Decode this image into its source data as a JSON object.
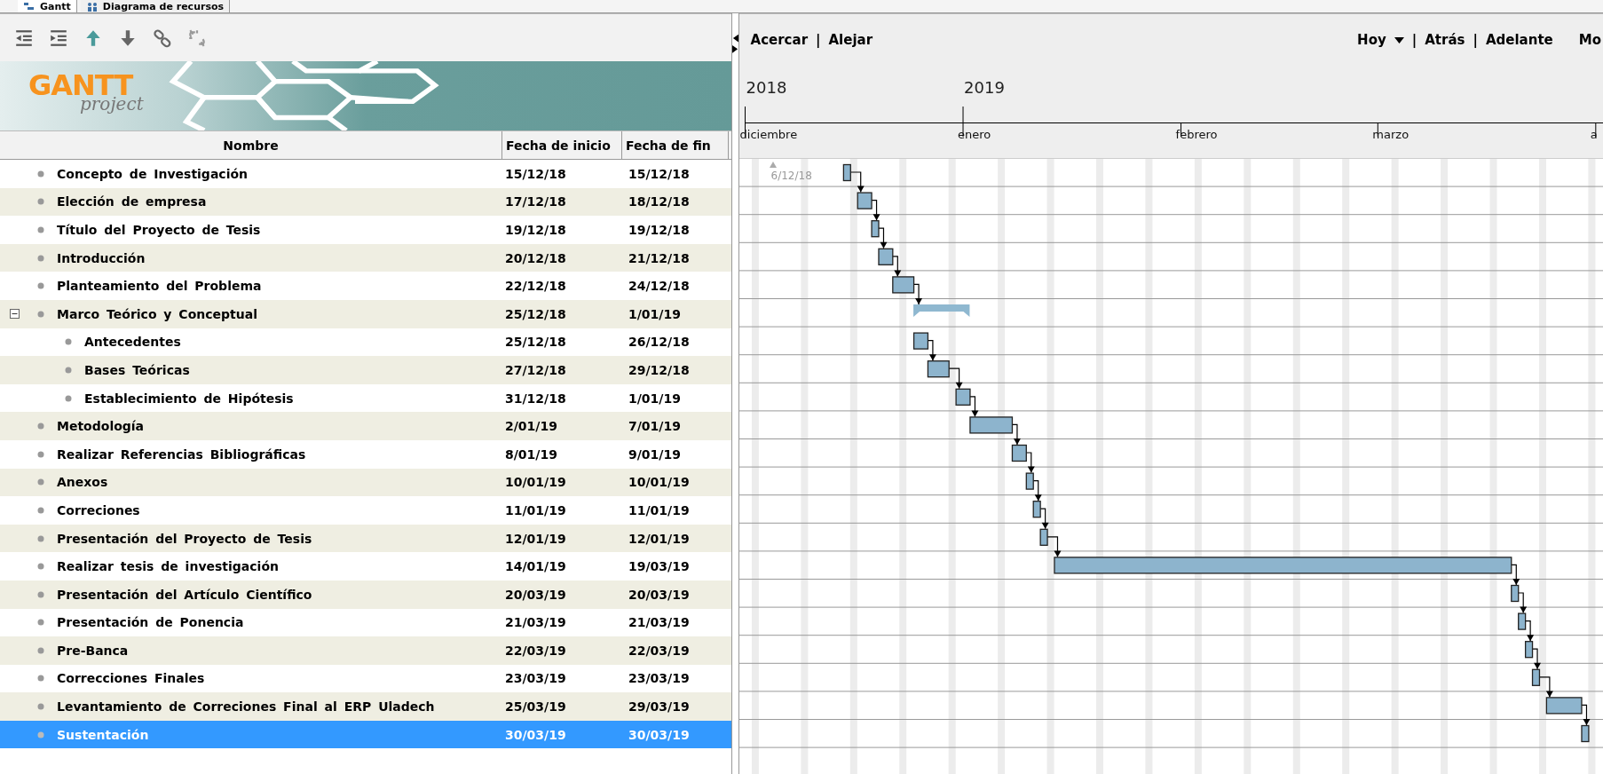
{
  "tabs": [
    {
      "label": "Gantt",
      "selected": true
    },
    {
      "label": "Diagrama de recursos",
      "selected": false
    }
  ],
  "logo": {
    "title": "GANTT",
    "subtitle": "project"
  },
  "table": {
    "columns": [
      "Nombre",
      "Fecha de inicio",
      "Fecha de fin"
    ],
    "rows": [
      {
        "name": "Concepto de Investigación",
        "start": "15/12/18",
        "end": "15/12/18",
        "selected": false
      },
      {
        "name": "Elección de empresa",
        "start": "17/12/18",
        "end": "18/12/18",
        "selected": false
      },
      {
        "name": "Título del Proyecto de Tesis",
        "start": "19/12/18",
        "end": "19/12/18",
        "selected": false
      },
      {
        "name": "Introducción",
        "start": "20/12/18",
        "end": "21/12/18",
        "selected": false
      },
      {
        "name": "Planteamiento del Problema",
        "start": "22/12/18",
        "end": "24/12/18",
        "selected": false
      },
      {
        "name": "Marco Teórico y Conceptual",
        "start": "25/12/18",
        "end": "1/01/19",
        "selected": false,
        "expanded": true,
        "children": [
          {
            "name": "Antecedentes",
            "start": "25/12/18",
            "end": "26/12/18",
            "selected": false
          },
          {
            "name": "Bases Teóricas",
            "start": "27/12/18",
            "end": "29/12/18",
            "selected": false
          },
          {
            "name": "Establecimiento de Hipótesis",
            "start": "31/12/18",
            "end": "1/01/19",
            "selected": false
          }
        ]
      },
      {
        "name": "Metodología",
        "start": "2/01/19",
        "end": "7/01/19",
        "selected": false
      },
      {
        "name": "Realizar Referencias Bibliográficas",
        "start": "8/01/19",
        "end": "9/01/19",
        "selected": false
      },
      {
        "name": "Anexos",
        "start": "10/01/19",
        "end": "10/01/19",
        "selected": false
      },
      {
        "name": "Correciones",
        "start": "11/01/19",
        "end": "11/01/19",
        "selected": false
      },
      {
        "name": "Presentación del Proyecto de Tesis",
        "start": "12/01/19",
        "end": "12/01/19",
        "selected": false
      },
      {
        "name": "Realizar tesis de investigación",
        "start": "14/01/19",
        "end": "19/03/19",
        "selected": false
      },
      {
        "name": "Presentación del Artículo Científico",
        "start": "20/03/19",
        "end": "20/03/19",
        "selected": false
      },
      {
        "name": "Presentación de Ponencia",
        "start": "21/03/19",
        "end": "21/03/19",
        "selected": false
      },
      {
        "name": "Pre-Banca",
        "start": "22/03/19",
        "end": "22/03/19",
        "selected": false
      },
      {
        "name": "Correcciones Finales",
        "start": "23/03/19",
        "end": "23/03/19",
        "selected": false
      },
      {
        "name": "Levantamiento de Correciones Final al ERP Uladech",
        "start": "25/03/19",
        "end": "29/03/19",
        "selected": false
      },
      {
        "name": "Sustentación",
        "start": "30/03/19",
        "end": "30/03/19",
        "selected": true
      }
    ]
  },
  "chart_toolbar": {
    "zoom_in": "Acercar",
    "separator_1": "|",
    "zoom_out": "Alejar",
    "today": "Hoy",
    "separator_2": "|",
    "back": "Atrás",
    "separator_3": "|",
    "forward": "Adelante",
    "more": "Mo"
  },
  "timeline": {
    "years": [
      "2018",
      "2019"
    ],
    "months": [
      "diciembre",
      "enero",
      "febrero",
      "marzo",
      "a"
    ],
    "marker": "6/12/18"
  }
}
